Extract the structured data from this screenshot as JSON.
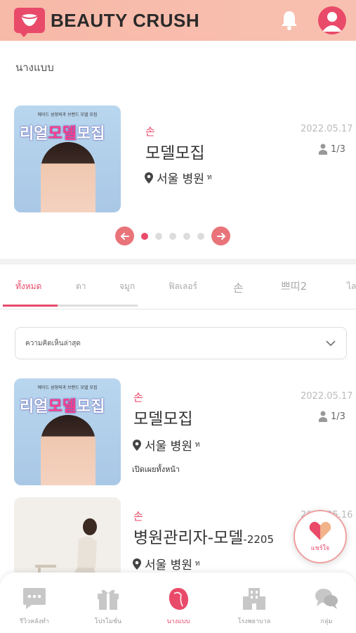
{
  "header": {
    "brand": "BEAUTY CRUSH"
  },
  "section_title": "นางแบบ",
  "featured": {
    "poster_top": "에이드 성형외과 브랜드 모델 모집",
    "poster_title_a": "리얼",
    "poster_title_b": "모델",
    "poster_title_c": "모집",
    "category": "손",
    "title": "모델모집",
    "location": "서울 병원",
    "location_suffix": "ท",
    "date": "2022.05.17",
    "count": "1/3",
    "dots": 5,
    "active_dot": 0
  },
  "tabs": [
    "ทั้งหมด",
    "ตา",
    "จมูก",
    "ฟิลเลอร์",
    "손",
    "쁘띠2",
    "ไล"
  ],
  "sort_select": {
    "value": "ความคิดเห็นล่าสุด"
  },
  "list": [
    {
      "category": "손",
      "title": "모델모집",
      "location": "서울 병원",
      "location_suffix": "ท",
      "date": "2022.05.17",
      "count": "1/3",
      "extra": "เปิดเผยทั้งหน้า"
    },
    {
      "category": "손",
      "title": "병원관리자-모델",
      "title_suffix": "-2205",
      "location": "서울 병원",
      "location_suffix": "ท",
      "date": "2022.05.16"
    }
  ],
  "fab": {
    "label": "แชร์ใจ"
  },
  "bottom_nav": [
    {
      "label": "รีวิวหลังทำ",
      "icon": "chat-icon"
    },
    {
      "label": "โปรโมชั่น",
      "icon": "gift-icon"
    },
    {
      "label": "นางแบบ",
      "icon": "model-icon",
      "active": true
    },
    {
      "label": "โรงพยาบาล",
      "icon": "hospital-icon"
    },
    {
      "label": "กลุ่ม",
      "icon": "group-chat-icon"
    }
  ],
  "colors": {
    "accent": "#e94a6a",
    "header_bg": "#f7b9a8"
  }
}
